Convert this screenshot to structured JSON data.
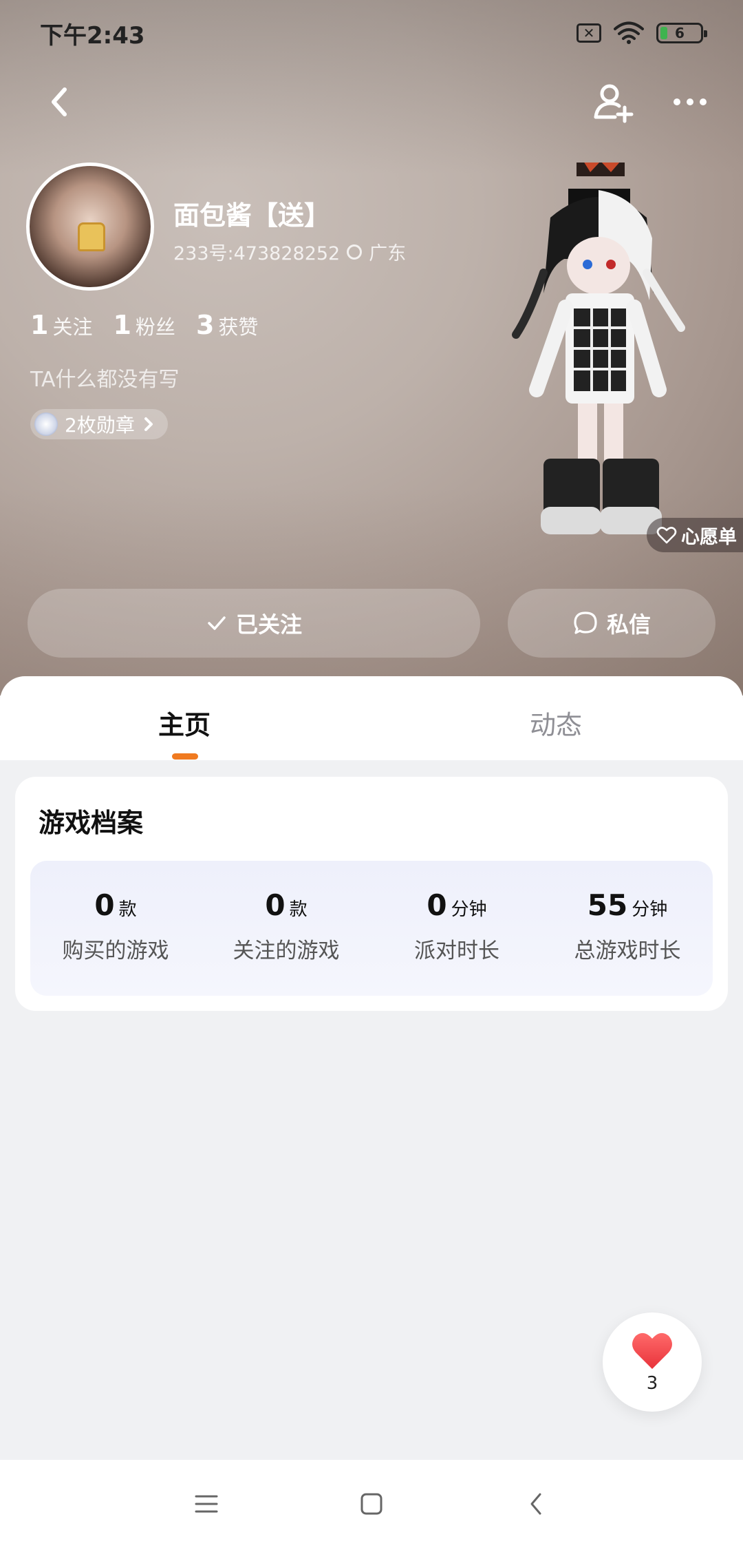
{
  "status_bar": {
    "time": "下午2:43",
    "battery": "6"
  },
  "profile": {
    "nickname": "面包酱【送】",
    "account_id": "233号:473828252",
    "location": "广东",
    "bio": "TA什么都没有写",
    "badge": "2枚勋章",
    "stats": [
      {
        "num": "1",
        "label": "关注"
      },
      {
        "num": "1",
        "label": "粉丝"
      },
      {
        "num": "3",
        "label": "获赞"
      }
    ]
  },
  "actions": {
    "wishlist": "心愿单",
    "followed": "已关注",
    "message": "私信"
  },
  "tabs": [
    {
      "label": "主页",
      "active": true
    },
    {
      "label": "动态",
      "active": false
    }
  ],
  "game_profile": {
    "title": "游戏档案",
    "items": [
      {
        "value": "0",
        "unit": "款",
        "caption": "购买的游戏"
      },
      {
        "value": "0",
        "unit": "款",
        "caption": "关注的游戏"
      },
      {
        "value": "0",
        "unit": "分钟",
        "caption": "派对时长"
      },
      {
        "value": "55",
        "unit": "分钟",
        "caption": "总游戏时长"
      }
    ]
  },
  "like": {
    "count": "3"
  },
  "colors": {
    "accent": "#f07a20",
    "like": "#f0484e"
  }
}
